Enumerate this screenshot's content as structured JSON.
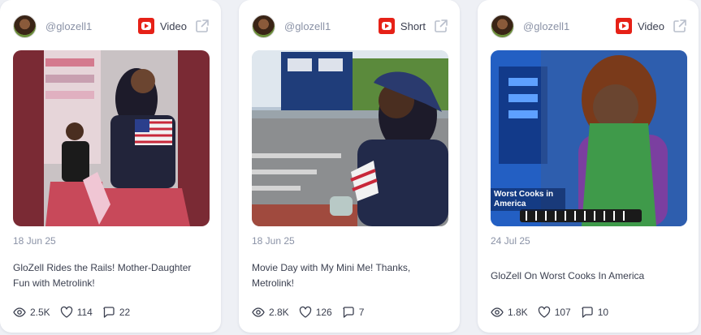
{
  "colors": {
    "youtube_red": "#e62117",
    "muted_text": "#8a92a6",
    "body_text": "#3a3f4f",
    "card_bg": "#ffffff",
    "page_bg": "#eef0f5"
  },
  "cards": [
    {
      "handle": "@glozell1",
      "platform_icon": "youtube-icon",
      "type": "Video",
      "date": "18 Jun 25",
      "title": "GloZell Rides the Rails! Mother-Daughter Fun with Metrolink!",
      "views": "2.5K",
      "likes": "114",
      "comments": "22"
    },
    {
      "handle": "@glozell1",
      "platform_icon": "youtube-icon",
      "type": "Short",
      "date": "18 Jun 25",
      "title": "Movie Day with My Mini Me! Thanks, Metrolink!",
      "views": "2.8K",
      "likes": "126",
      "comments": "7"
    },
    {
      "handle": "@glozell1",
      "platform_icon": "youtube-icon",
      "type": "Video",
      "date": "24 Jul 25",
      "title": "GloZell On Worst Cooks In America",
      "views": "1.8K",
      "likes": "107",
      "comments": "10",
      "thumbnail_text": "Worst Cooks in America"
    }
  ]
}
